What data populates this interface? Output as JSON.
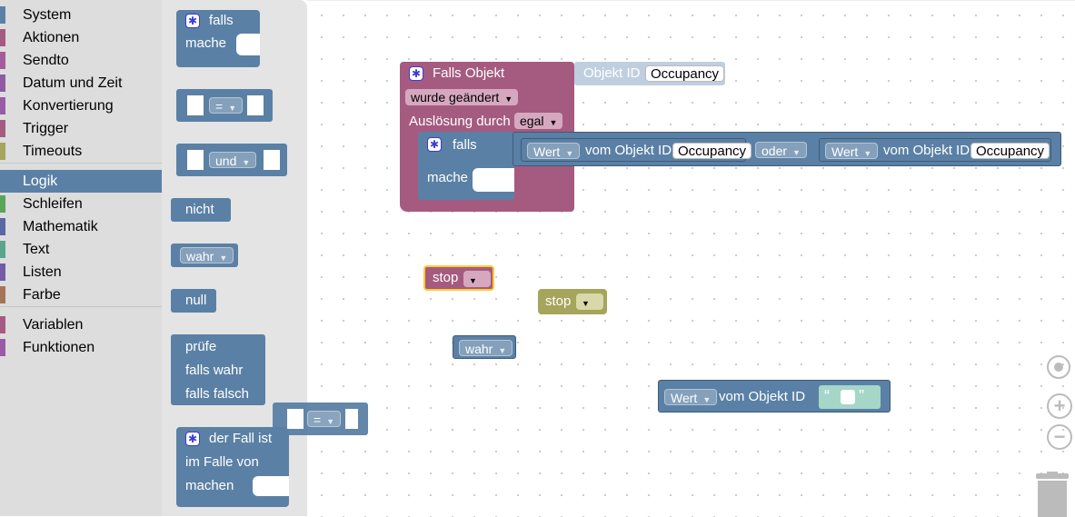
{
  "toolbox": {
    "categories": [
      {
        "label": "System",
        "color": "#5b80a5"
      },
      {
        "label": "Aktionen",
        "color": "#a55b80"
      },
      {
        "label": "Sendto",
        "color": "#a55b99"
      },
      {
        "label": "Datum und Zeit",
        "color": "#8e5ba5"
      },
      {
        "label": "Konvertierung",
        "color": "#995ba5"
      },
      {
        "label": "Trigger",
        "color": "#a55b80"
      },
      {
        "label": "Timeouts",
        "color": "#a5a55b"
      },
      {
        "label": "Logik",
        "color": "#5b80a5"
      },
      {
        "label": "Schleifen",
        "color": "#5ba55b"
      },
      {
        "label": "Mathematik",
        "color": "#5b67a5"
      },
      {
        "label": "Text",
        "color": "#5ba58c"
      },
      {
        "label": "Listen",
        "color": "#745ba5"
      },
      {
        "label": "Farbe",
        "color": "#a5745b"
      },
      {
        "label": "Variablen",
        "color": "#a55b80"
      },
      {
        "label": "Funktionen",
        "color": "#995ba5"
      }
    ]
  },
  "flyout": {
    "if_block": {
      "falls": "falls",
      "mache": "mache"
    },
    "compare_block": {
      "op": "="
    },
    "and_block": {
      "op": "und"
    },
    "not_block": {
      "label": "nicht"
    },
    "bool_block": {
      "value": "wahr"
    },
    "null_block": {
      "label": "null"
    },
    "ternary_block": {
      "pruefe": "prüfe",
      "falls_wahr": "falls wahr",
      "falls_falsch": "falls falsch"
    },
    "switch_block": {
      "fall": "der Fall ist",
      "im_falle": "im Falle von",
      "machen": "machen"
    }
  },
  "workspace": {
    "event_block": {
      "title": "Falls Objekt",
      "objid_label": "Objekt ID",
      "objid_value": "Occupancy",
      "trigger_value": "wurde geändert",
      "ausloesung_label": "Auslösung durch",
      "ausloesung_value": "egal"
    },
    "inner_if": {
      "falls": "falls",
      "mache": "mache",
      "left_wert": "Wert",
      "left_vom": "vom Objekt ID",
      "left_id": "Occupancy",
      "op": "oder",
      "right_wert": "Wert",
      "right_vom": "vom Objekt ID",
      "right_id": "Occupancy"
    },
    "stop_block_1": {
      "label": "stop"
    },
    "stop_block_2": {
      "label": "stop"
    },
    "bool_block": {
      "value": "wahr"
    },
    "dragged_compare": {
      "op": "="
    },
    "wert_block": {
      "wert": "Wert",
      "vom": "vom Objekt ID",
      "quote_open": "“",
      "quote_close": "”"
    }
  },
  "controls": {
    "zoom_in": "+",
    "zoom_out": "−"
  }
}
